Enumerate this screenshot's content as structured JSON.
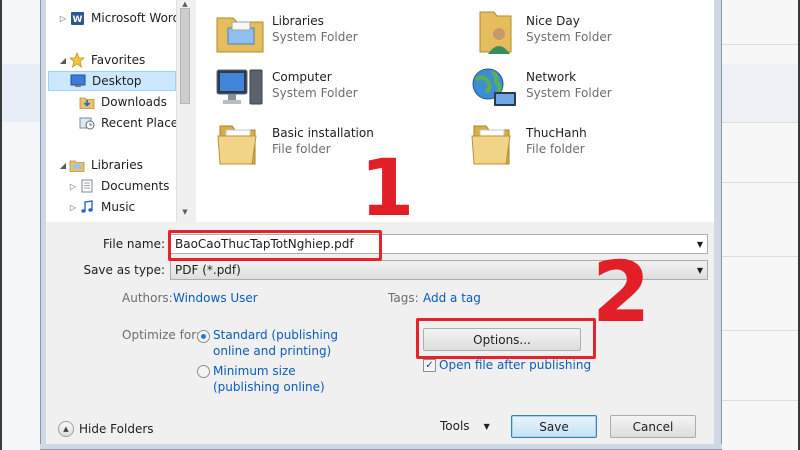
{
  "nav": {
    "items": [
      {
        "label": "Microsoft Word",
        "icon": "word-icon"
      },
      {
        "label": "Favorites",
        "icon": "star-icon"
      },
      {
        "label": "Desktop",
        "icon": "desktop-icon",
        "selected": true
      },
      {
        "label": "Downloads",
        "icon": "downloads-folder-icon"
      },
      {
        "label": "Recent Places",
        "icon": "recent-places-icon"
      },
      {
        "label": "Libraries",
        "icon": "libraries-icon"
      },
      {
        "label": "Documents",
        "icon": "documents-icon"
      },
      {
        "label": "Music",
        "icon": "music-icon"
      }
    ]
  },
  "content": {
    "items": [
      {
        "name": "Libraries",
        "type": "System Folder",
        "icon": "libraries-folder-icon"
      },
      {
        "name": "Nice Day",
        "type": "System Folder",
        "icon": "user-folder-icon"
      },
      {
        "name": "Computer",
        "type": "System Folder",
        "icon": "computer-icon"
      },
      {
        "name": "Network",
        "type": "System Folder",
        "icon": "network-icon"
      },
      {
        "name": "Basic installation",
        "type": "File folder",
        "icon": "folder-icon"
      },
      {
        "name": "ThucHanh",
        "type": "File folder",
        "icon": "folder-icon"
      }
    ]
  },
  "form": {
    "file_name_label": "File name:",
    "file_name_value": "BaoCaoThucTapTotNghiep.pdf",
    "save_type_label": "Save as type:",
    "save_type_value": "PDF (*.pdf)",
    "authors_label": "Authors:",
    "authors_value": "Windows User",
    "tags_label": "Tags:",
    "tags_value": "Add a tag",
    "optimize_label": "Optimize for:",
    "option_standard_line1": "Standard (publishing",
    "option_standard_line2": "online and printing)",
    "option_minimum_line1": "Minimum size",
    "option_minimum_line2": "(publishing online)",
    "options_button": "Options...",
    "open_after_label": "Open file after publishing"
  },
  "footer": {
    "hide_folders": "Hide Folders",
    "tools": "Tools",
    "save": "Save",
    "cancel": "Cancel"
  },
  "annotations": {
    "step1": "1",
    "step2": "2",
    "color": "#e21f26"
  }
}
